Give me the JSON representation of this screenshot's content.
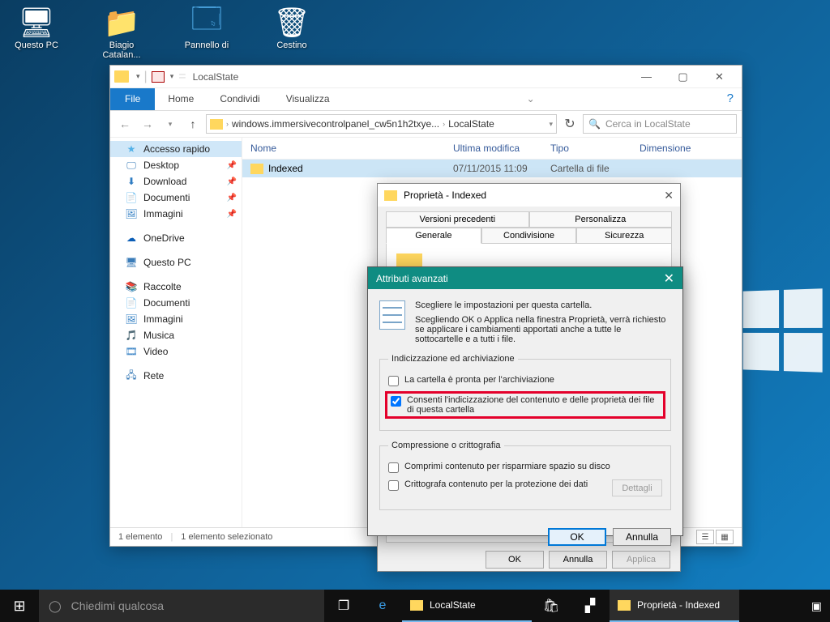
{
  "desktop": {
    "icons": [
      {
        "label": "Questo PC",
        "glyph": "🖥"
      },
      {
        "label": "Biagio Catalan...",
        "glyph": "👤"
      },
      {
        "label": "Pannello di",
        "glyph": "🗔"
      },
      {
        "label": "Cestino",
        "glyph": "🗑"
      }
    ]
  },
  "explorer": {
    "title": "LocalState",
    "ribbon": {
      "file": "File",
      "tabs": [
        "Home",
        "Condividi",
        "Visualizza"
      ]
    },
    "breadcrumb": {
      "seg1": "windows.immersivecontrolpanel_cw5n1h2txye...",
      "seg2": "LocalState"
    },
    "search_placeholder": "Cerca in LocalState",
    "nav": {
      "quick": "Accesso rapido",
      "desktop": "Desktop",
      "download": "Download",
      "documenti": "Documenti",
      "immagini": "Immagini",
      "onedrive": "OneDrive",
      "questopc": "Questo PC",
      "raccolte": "Raccolte",
      "rdocumenti": "Documenti",
      "rimmagini": "Immagini",
      "rmusica": "Musica",
      "rvideo": "Video",
      "rete": "Rete"
    },
    "cols": {
      "c1": "Nome",
      "c2": "Ultima modifica",
      "c3": "Tipo",
      "c4": "Dimensione"
    },
    "row": {
      "name": "Indexed",
      "date": "07/11/2015 11:09",
      "type": "Cartella di file"
    },
    "status": {
      "s1": "1 elemento",
      "s2": "1 elemento selezionato"
    }
  },
  "props": {
    "title": "Proprietà - Indexed",
    "tabs_top": [
      "Versioni precedenti",
      "Personalizza"
    ],
    "tabs_bot": [
      "Generale",
      "Condivisione",
      "Sicurezza"
    ],
    "buttons": {
      "ok": "OK",
      "cancel": "Annulla",
      "apply": "Applica"
    }
  },
  "adv": {
    "title": "Attributi avanzati",
    "intro1": "Scegliere le impostazioni per questa cartella.",
    "intro2": "Scegliendo OK o Applica nella finestra Proprietà, verrà richiesto se applicare i cambiamenti apportati anche a tutte le sottocartelle e a tutti i file.",
    "group1": "Indicizzazione ed archiviazione",
    "chk1": "La cartella è pronta per l'archiviazione",
    "chk2": "Consenti l'indicizzazione del contenuto e delle proprietà dei file di questa cartella",
    "group2": "Compressione o crittografia",
    "chk3": "Comprimi contenuto per risparmiare spazio su disco",
    "chk4": "Crittografa contenuto per la protezione dei dati",
    "details": "Dettagli",
    "ok": "OK",
    "cancel": "Annulla"
  },
  "taskbar": {
    "cortana": "Chiedimi qualcosa",
    "app1": "LocalState",
    "app2": "Proprietà - Indexed"
  }
}
